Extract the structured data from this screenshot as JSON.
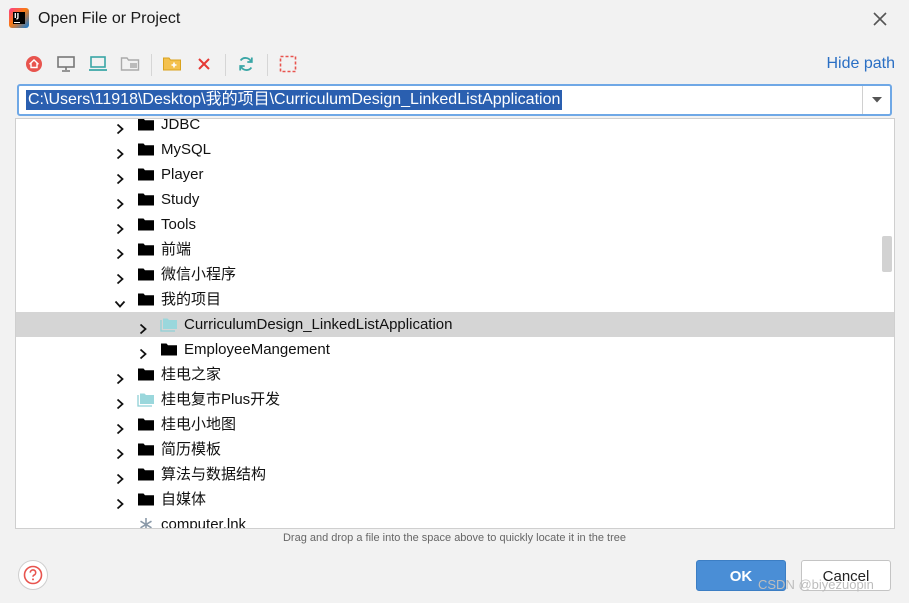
{
  "window": {
    "title": "Open File or Project",
    "close_icon": "close-icon"
  },
  "toolbar": {
    "icons": [
      "home-icon",
      "desktop-icon",
      "project-icon",
      "module-icon",
      "new-folder-icon",
      "delete-icon",
      "refresh-icon",
      "show-hidden-icon"
    ],
    "hide_path_label": "Hide path"
  },
  "path": {
    "value": "C:\\Users\\11918\\Desktop\\我的项目\\CurriculumDesign_LinkedListApplication"
  },
  "tree": {
    "rows": [
      {
        "label": "JDBC",
        "level": 0,
        "expanded": false,
        "icon": "folder-icon"
      },
      {
        "label": "MySQL",
        "level": 0,
        "expanded": false,
        "icon": "folder-icon"
      },
      {
        "label": "Player",
        "level": 0,
        "expanded": false,
        "icon": "folder-icon"
      },
      {
        "label": "Study",
        "level": 0,
        "expanded": false,
        "icon": "folder-icon"
      },
      {
        "label": "Tools",
        "level": 0,
        "expanded": false,
        "icon": "folder-icon"
      },
      {
        "label": "前端",
        "level": 0,
        "expanded": false,
        "icon": "folder-icon"
      },
      {
        "label": "微信小程序",
        "level": 0,
        "expanded": false,
        "icon": "folder-icon"
      },
      {
        "label": "我的项目",
        "level": 0,
        "expanded": true,
        "icon": "folder-icon"
      },
      {
        "label": "CurriculumDesign_LinkedListApplication",
        "level": 1,
        "expanded": false,
        "icon": "project-folder-icon",
        "selected": true
      },
      {
        "label": "EmployeeMangement",
        "level": 1,
        "expanded": false,
        "icon": "folder-icon"
      },
      {
        "label": "桂电之家",
        "level": 0,
        "expanded": false,
        "icon": "folder-icon"
      },
      {
        "label": "桂电复市Plus开发",
        "level": 0,
        "expanded": false,
        "icon": "project-folder-icon"
      },
      {
        "label": "桂电小地图",
        "level": 0,
        "expanded": false,
        "icon": "folder-icon"
      },
      {
        "label": "简历模板",
        "level": 0,
        "expanded": false,
        "icon": "folder-icon"
      },
      {
        "label": "算法与数据结构",
        "level": 0,
        "expanded": false,
        "icon": "folder-icon"
      },
      {
        "label": "自媒体",
        "level": 0,
        "expanded": false,
        "icon": "folder-icon"
      },
      {
        "label": "computer.lnk",
        "level": 0,
        "expanded": null,
        "icon": "file-asterisk-icon"
      }
    ]
  },
  "hint": "Drag and drop a file into the space above to quickly locate it in the tree",
  "buttons": {
    "ok": "OK",
    "cancel": "Cancel"
  },
  "watermark": "CSDN @biyezuopin",
  "colors": {
    "accent": "#4a8ed6",
    "selection": "#2a5fb0",
    "row_selected": "#d5d5d5",
    "link": "#2a6fc4",
    "red": "#e53935"
  }
}
